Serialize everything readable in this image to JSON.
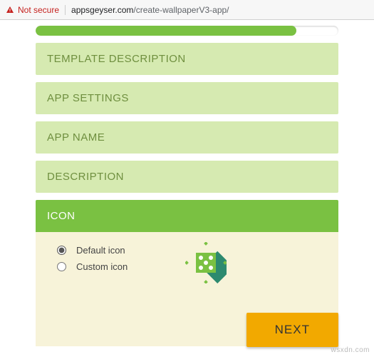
{
  "address_bar": {
    "security_label": "Not secure",
    "domain": "appsgeyser.com",
    "path": "/create-wallpaperV3-app/"
  },
  "progress": {
    "percent": 86
  },
  "panels": {
    "template_description": "TEMPLATE DESCRIPTION",
    "app_settings": "APP SETTINGS",
    "app_name": "APP NAME",
    "description": "DESCRIPTION",
    "icon": "ICON"
  },
  "icon_section": {
    "options": {
      "default": "Default icon",
      "custom": "Custom icon"
    },
    "selected": "default"
  },
  "buttons": {
    "next": "NEXT"
  },
  "watermark": "wsxdn.com"
}
